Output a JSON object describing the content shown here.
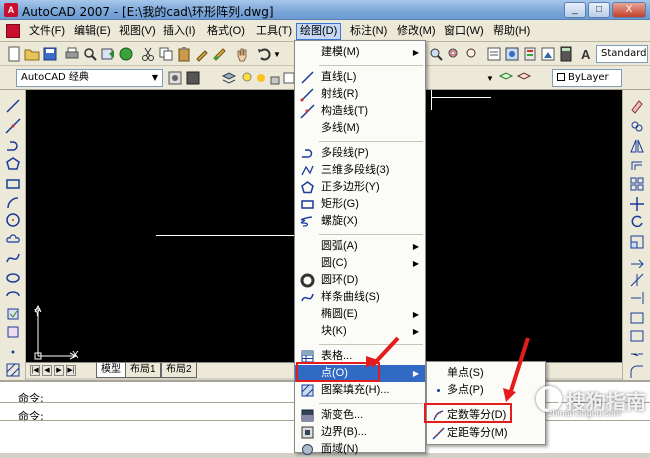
{
  "window": {
    "app_badge": "A",
    "title": "AutoCAD 2007 - [E:\\我的cad\\环形阵列.dwg]",
    "controls": [
      "_",
      "□",
      "X"
    ]
  },
  "menubar": {
    "items": [
      "文件(F)",
      "编辑(E)",
      "视图(V)",
      "插入(I)",
      "格式(O)",
      "工具(T)",
      "绘图(D)",
      "标注(N)",
      "修改(M)",
      "窗口(W)",
      "帮助(H)"
    ],
    "active": "绘图(D)"
  },
  "toolbar": {
    "text_style": "Standard",
    "workspace": "AutoCAD 经典",
    "layer_prop": "ByLayer"
  },
  "draw_menu": {
    "items": [
      {
        "label": "建模(M)",
        "icon": "none",
        "submenu": true
      },
      {
        "label": "直线(L)",
        "icon": "line-icon",
        "submenu": false
      },
      {
        "label": "射线(R)",
        "icon": "ray-icon",
        "submenu": false
      },
      {
        "label": "构造线(T)",
        "icon": "xline-icon",
        "submenu": false
      },
      {
        "label": "多线(M)",
        "icon": "none",
        "submenu": false
      },
      {
        "label": "多段线(P)",
        "icon": "polyline-icon",
        "submenu": false
      },
      {
        "label": "三维多段线(3)",
        "icon": "3dpoly-icon",
        "submenu": false
      },
      {
        "label": "正多边形(Y)",
        "icon": "polygon-icon",
        "submenu": false
      },
      {
        "label": "矩形(G)",
        "icon": "rectangle-icon",
        "submenu": false
      },
      {
        "label": "螺旋(X)",
        "icon": "helix-icon",
        "submenu": false
      },
      {
        "label": "圆弧(A)",
        "icon": "none",
        "submenu": true
      },
      {
        "label": "圆(C)",
        "icon": "none",
        "submenu": true
      },
      {
        "label": "圆环(D)",
        "icon": "donut-icon",
        "submenu": false
      },
      {
        "label": "样条曲线(S)",
        "icon": "spline-icon",
        "submenu": false
      },
      {
        "label": "椭圆(E)",
        "icon": "none",
        "submenu": true
      },
      {
        "label": "块(K)",
        "icon": "none",
        "submenu": true
      },
      {
        "label": "表格...",
        "icon": "table-icon",
        "submenu": false
      },
      {
        "label": "点(O)",
        "icon": "none",
        "submenu": true
      },
      {
        "label": "图案填充(H)...",
        "icon": "hatch-icon",
        "submenu": false
      },
      {
        "label": "渐变色...",
        "icon": "gradient-icon",
        "submenu": false
      },
      {
        "label": "边界(B)...",
        "icon": "boundary-icon",
        "submenu": false
      },
      {
        "label": "面域(N)",
        "icon": "region-icon",
        "submenu": false
      }
    ],
    "highlighted": "点(O)"
  },
  "point_submenu": {
    "items": [
      {
        "label": "单点(S)",
        "icon": "none"
      },
      {
        "label": "多点(P)",
        "icon": "point-icon"
      },
      {
        "label": "定数等分(D)",
        "icon": "divide-icon"
      },
      {
        "label": "定距等分(M)",
        "icon": "measure-icon"
      }
    ]
  },
  "layout_tabs": [
    "模型",
    "布局1",
    "布局2"
  ],
  "command": {
    "line1": "命令:",
    "line2": "命令:"
  },
  "ucs": {
    "x": "X",
    "y": "Y"
  },
  "watermark": {
    "brand": "搜狗指南",
    "url": "zhinan.sogou.com"
  },
  "colors": {
    "highlight": "#316ac5",
    "annotation": "#e51c1c",
    "canvas": "#000000"
  }
}
